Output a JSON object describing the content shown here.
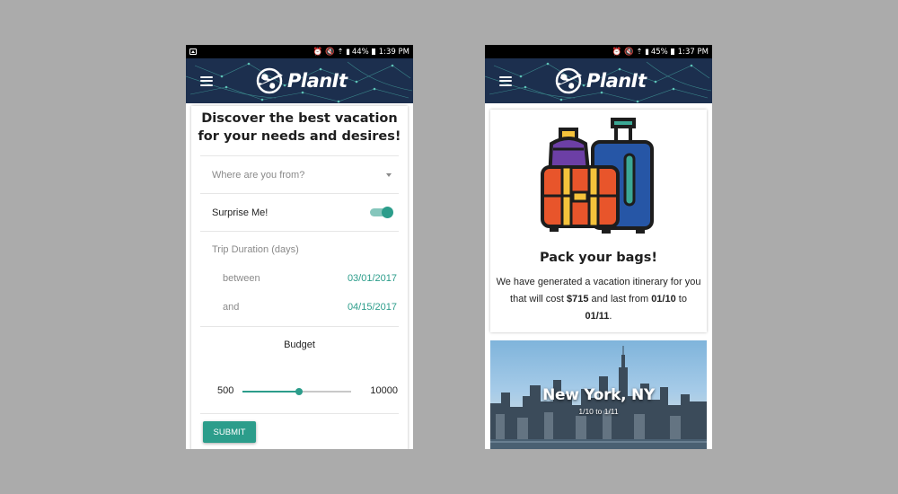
{
  "colors": {
    "accent": "#2c9d8b",
    "appbar": "#1c2f4e",
    "backdrop": "#ababab"
  },
  "left_screen": {
    "statusbar": {
      "battery": "44%",
      "time": "1:39 PM"
    },
    "appbar": {
      "menu_icon": "hamburger-menu-icon",
      "logo_text": "PlanIt"
    },
    "form": {
      "headline_line1": "Discover the best vacation",
      "headline_line2": "for your needs and desires!",
      "origin_placeholder": "Where are you from?",
      "surprise_label": "Surprise Me!",
      "surprise_on": true,
      "duration_title": "Trip Duration (days)",
      "between_label": "between",
      "between_value": "03/01/2017",
      "and_label": "and",
      "and_value": "04/15/2017",
      "budget_title": "Budget",
      "budget_min": "500",
      "budget_max": "10000",
      "budget_slider_fraction": 0.52,
      "submit_label": "SUBMIT"
    }
  },
  "right_screen": {
    "statusbar": {
      "battery": "45%",
      "time": "1:37 PM"
    },
    "appbar": {
      "menu_icon": "hamburger-menu-icon",
      "logo_text": "PlanIt"
    },
    "summary": {
      "title": "Pack your bags!",
      "text_1": "We have generated a vacation itinerary for you that will cost ",
      "cost": "$715",
      "text_2": " and last from ",
      "start": "01/10",
      "text_3": " to ",
      "end": "01/11",
      "text_4": "."
    },
    "destination": {
      "city": "New York, NY",
      "dates": "1/10 to 1/11"
    }
  }
}
